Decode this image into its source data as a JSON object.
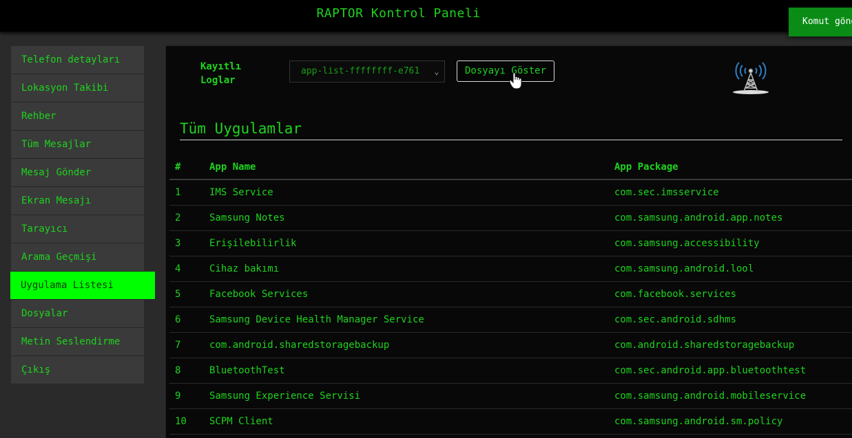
{
  "header": {
    "title": "RAPTOR Kontrol Paneli",
    "command_button": "Komut gönder"
  },
  "sidebar": {
    "items": [
      {
        "label": "Telefon detayları"
      },
      {
        "label": "Lokasyon Takibi"
      },
      {
        "label": "Rehber"
      },
      {
        "label": "Tüm Mesajlar"
      },
      {
        "label": "Mesaj Gönder"
      },
      {
        "label": "Ekran Mesajı"
      },
      {
        "label": "Tarayıcı"
      },
      {
        "label": "Arama Geçmişi"
      },
      {
        "label": "Uygulama Listesi"
      },
      {
        "label": "Dosyalar"
      },
      {
        "label": "Metin Seslendirme"
      },
      {
        "label": "Çıkış"
      }
    ],
    "active_index": 8
  },
  "logs": {
    "label": "Kayıtlı Loglar",
    "selected": "app-list-ffffffff-e761",
    "show_button": "Dosyayı Göster"
  },
  "section": {
    "title": "Tüm Uygulamlar"
  },
  "table": {
    "headers": [
      "#",
      "App Name",
      "App Package"
    ],
    "rows": [
      [
        "1",
        "IMS Service",
        "com.sec.imsservice"
      ],
      [
        "2",
        "Samsung Notes",
        "com.samsung.android.app.notes"
      ],
      [
        "3",
        "Erişilebilirlik",
        "com.samsung.accessibility"
      ],
      [
        "4",
        "Cihaz bakımı",
        "com.samsung.android.lool"
      ],
      [
        "5",
        "Facebook Services",
        "com.facebook.services"
      ],
      [
        "6",
        "Samsung Device Health Manager Service",
        "com.sec.android.sdhms"
      ],
      [
        "7",
        "com.android.sharedstoragebackup",
        "com.android.sharedstoragebackup"
      ],
      [
        "8",
        "BluetoothTest",
        "com.sec.android.app.bluetoothtest"
      ],
      [
        "9",
        "Samsung Experience Servisi",
        "com.samsung.android.mobileservice"
      ],
      [
        "10",
        "SCPM Client",
        "com.samsung.android.sm.policy"
      ]
    ]
  },
  "icons": {
    "tower": "radio-tower-icon",
    "cursor": "hand-pointer-icon",
    "select_chevron": "chevron-down-icon"
  },
  "colors": {
    "accent": "#1ed31e",
    "active_bg": "#00ff00",
    "command_bg": "#0a8c16",
    "background": "#080808"
  }
}
